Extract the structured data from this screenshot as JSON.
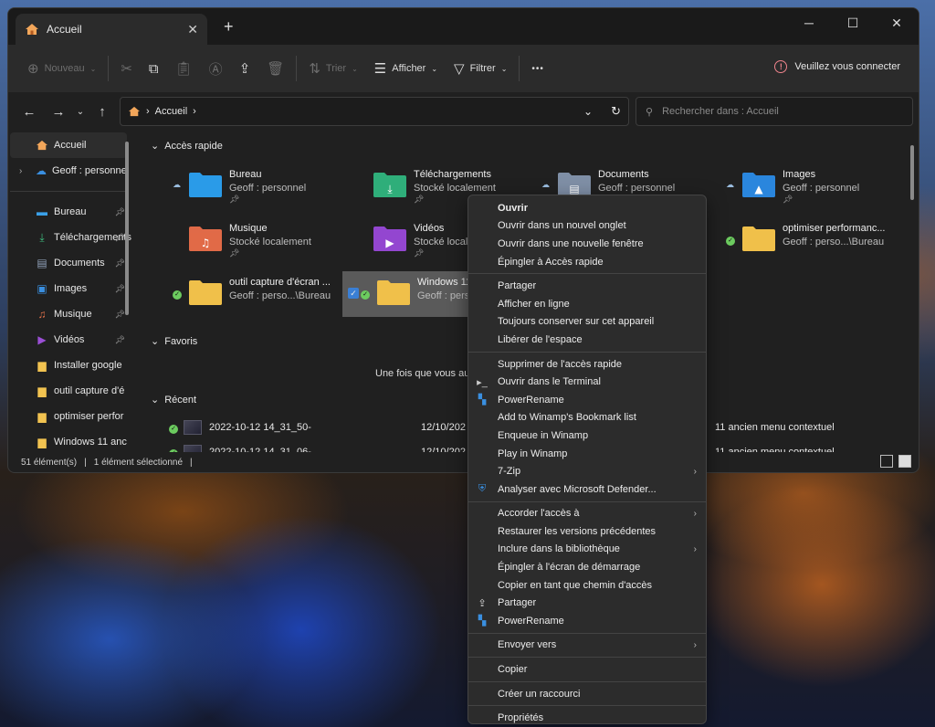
{
  "window": {
    "tab_title": "Accueil",
    "new_tab": "+",
    "controls": {
      "minimize": "─",
      "maximize": "☐",
      "close": "✕"
    }
  },
  "toolbar": {
    "new_label": "Nouveau",
    "sort_label": "Trier",
    "view_label": "Afficher",
    "filter_label": "Filtrer",
    "more_label": "•••",
    "signin_label": "Veuillez vous connecter"
  },
  "address": {
    "crumb_sep": "›",
    "location": "Accueil",
    "crumb_end": "›"
  },
  "search": {
    "placeholder": "Rechercher dans : Accueil"
  },
  "sidebar": {
    "home": "Accueil",
    "onedrive": "Geoff : personnel",
    "items": [
      {
        "label": "Bureau",
        "icon": "desktop-icon",
        "color": "#3aa0e8"
      },
      {
        "label": "Téléchargements",
        "icon": "download-icon",
        "color": "#3fbf7f"
      },
      {
        "label": "Documents",
        "icon": "document-icon",
        "color": "#8fa0b8"
      },
      {
        "label": "Images",
        "icon": "image-icon",
        "color": "#3a8fe0"
      },
      {
        "label": "Musique",
        "icon": "music-icon",
        "color": "#e0704a"
      },
      {
        "label": "Vidéos",
        "icon": "video-icon",
        "color": "#9b4fd6"
      },
      {
        "label": "Installer google",
        "icon": "folder-icon",
        "color": "#f2c350"
      },
      {
        "label": "outil capture d'é",
        "icon": "folder-icon",
        "color": "#f2c350"
      },
      {
        "label": "optimiser perfor",
        "icon": "folder-icon",
        "color": "#f2c350"
      },
      {
        "label": "Windows 11 anc",
        "icon": "folder-icon",
        "color": "#f2c350"
      }
    ]
  },
  "main": {
    "quick_access_title": "Accès rapide",
    "favorites_title": "Favoris",
    "favorites_empty": "Une fois que vous aurez",
    "recent_title": "Récent",
    "quick_access": [
      {
        "name": "Bureau",
        "sub": "Geoff : personnel",
        "icon": "desktop-folder-icon",
        "color": "#2a9be8",
        "status": "cloud"
      },
      {
        "name": "Téléchargements",
        "sub": "Stocké localement",
        "icon": "download-folder-icon",
        "color": "#2fae7a",
        "status": ""
      },
      {
        "name": "Documents",
        "sub": "Geoff : personnel",
        "icon": "document-folder-icon",
        "color": "#7f8fa6",
        "status": "cloud"
      },
      {
        "name": "Images",
        "sub": "Geoff : personnel",
        "icon": "image-folder-icon",
        "color": "#2a86dd",
        "status": "cloud"
      },
      {
        "name": "Musique",
        "sub": "Stocké localement",
        "icon": "music-folder-icon",
        "color": "#e06a48",
        "status": ""
      },
      {
        "name": "Vidéos",
        "sub": "Stocké localement",
        "icon": "video-folder-icon",
        "color": "#9346d0",
        "status": ""
      },
      {
        "name": "optimiser performanc...",
        "sub": "Geoff : perso...\\Bureau",
        "icon": "folder-icon",
        "color": "#f0c04a",
        "status": "ok"
      },
      {
        "name": "outil capture d'écran ...",
        "sub": "Geoff : perso...\\Bureau",
        "icon": "folder-icon",
        "color": "#f0c04a",
        "status": "ok"
      },
      {
        "name": "Windows 11 a",
        "sub": "Geoff : perso...",
        "icon": "folder-icon",
        "color": "#f0c04a",
        "status": "ok"
      }
    ],
    "recent": [
      {
        "name": "2022-10-12 14_31_50-",
        "date": "12/10/202",
        "location": "11 ancien menu contextuel"
      },
      {
        "name": "2022-10-12 14_31_06-",
        "date": "12/10/202",
        "location": "11 ancien menu contextuel"
      }
    ]
  },
  "status": {
    "count": "51 élément(s)",
    "selected": "1 élément sélectionné",
    "sep": "|"
  },
  "context_menu": {
    "groups": [
      [
        {
          "label": "Ouvrir",
          "bold": true,
          "icon": "",
          "submenu": false
        },
        {
          "label": "Ouvrir dans un nouvel onglet",
          "icon": "",
          "submenu": false
        },
        {
          "label": "Ouvrir dans une nouvelle fenêtre",
          "icon": "",
          "submenu": false
        },
        {
          "label": "Épingler à Accès rapide",
          "icon": "",
          "submenu": false
        }
      ],
      [
        {
          "label": "Partager",
          "icon": "",
          "submenu": false
        },
        {
          "label": "Afficher en ligne",
          "icon": "",
          "submenu": false
        },
        {
          "label": "Toujours conserver sur cet appareil",
          "icon": "",
          "submenu": false
        },
        {
          "label": "Libérer de l'espace",
          "icon": "",
          "submenu": false
        }
      ],
      [
        {
          "label": "Supprimer de l'accès rapide",
          "icon": "",
          "submenu": false
        },
        {
          "label": "Ouvrir dans le Terminal",
          "icon": "terminal-icon",
          "submenu": false
        },
        {
          "label": "PowerRename",
          "icon": "powerrename-icon",
          "submenu": false
        },
        {
          "label": "Add to Winamp's Bookmark list",
          "icon": "",
          "submenu": false
        },
        {
          "label": "Enqueue in Winamp",
          "icon": "",
          "submenu": false
        },
        {
          "label": "Play in Winamp",
          "icon": "",
          "submenu": false
        },
        {
          "label": "7-Zip",
          "icon": "",
          "submenu": true
        },
        {
          "label": "Analyser avec Microsoft Defender...",
          "icon": "defender-shield-icon",
          "submenu": false
        }
      ],
      [
        {
          "label": "Accorder l'accès à",
          "icon": "",
          "submenu": true
        },
        {
          "label": "Restaurer les versions précédentes",
          "icon": "",
          "submenu": false
        },
        {
          "label": "Inclure dans la bibliothèque",
          "icon": "",
          "submenu": true
        },
        {
          "label": "Épingler à l'écran de démarrage",
          "icon": "",
          "submenu": false
        },
        {
          "label": "Copier en tant que chemin d'accès",
          "icon": "",
          "submenu": false
        },
        {
          "label": "Partager",
          "icon": "share-icon",
          "submenu": false
        },
        {
          "label": "PowerRename",
          "icon": "powerrename-icon",
          "submenu": false
        }
      ],
      [
        {
          "label": "Envoyer vers",
          "icon": "",
          "submenu": true
        }
      ],
      [
        {
          "label": "Copier",
          "icon": "",
          "submenu": false
        }
      ],
      [
        {
          "label": "Créer un raccourci",
          "icon": "",
          "submenu": false
        }
      ],
      [
        {
          "label": "Propriétés",
          "icon": "",
          "submenu": false
        }
      ]
    ]
  }
}
